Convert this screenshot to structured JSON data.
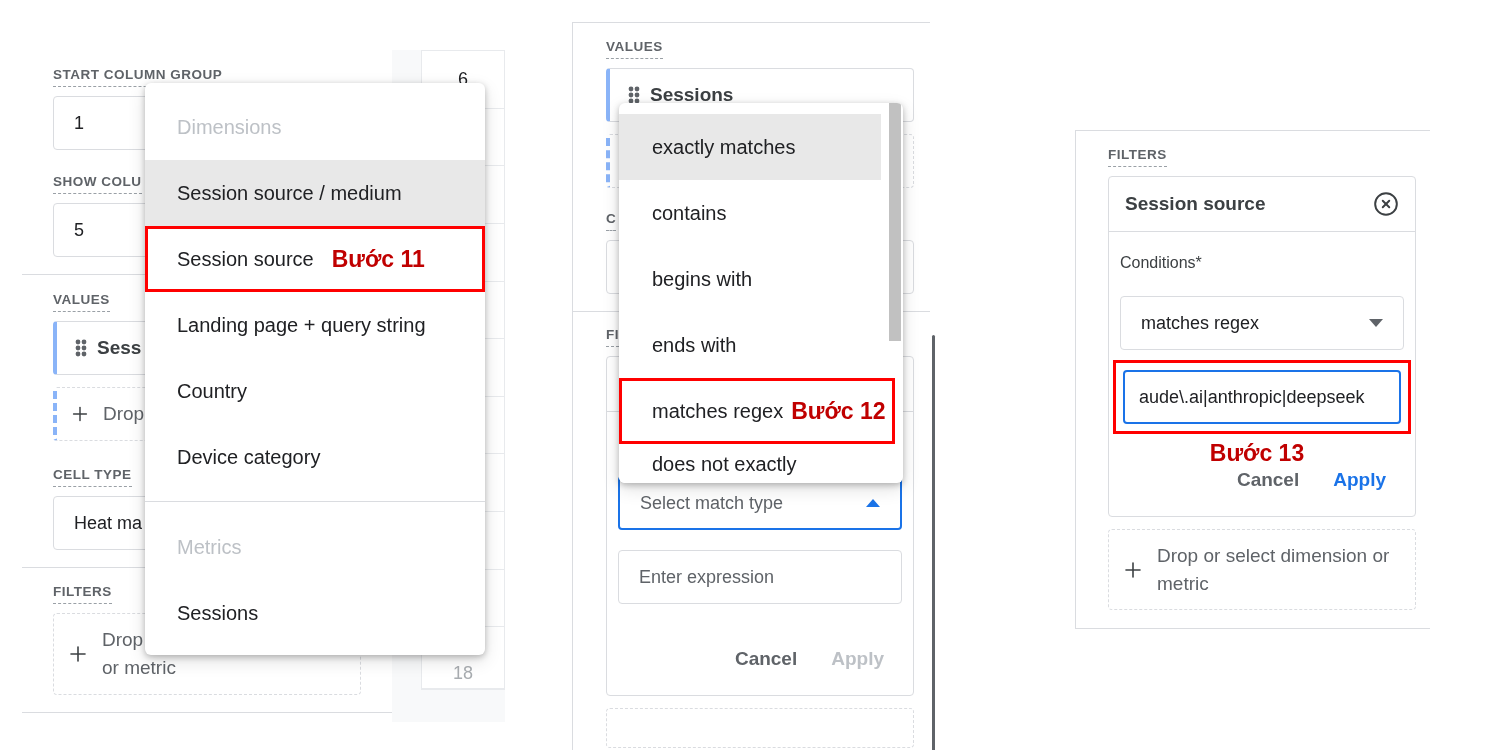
{
  "dimension_panel": {
    "fields": [
      {
        "label": "START COLUMN GROUP",
        "value": "1"
      },
      {
        "label": "SHOW COLU",
        "value": "5"
      }
    ],
    "values_label": "VALUES",
    "value_chip": "Sess",
    "drop_zone": "Drop",
    "cell_type": {
      "label": "CELL TYPE",
      "value": "Heat ma"
    },
    "filters_label": "FILTERS",
    "filters_drop": [
      "Drop",
      "or metric"
    ],
    "grid_cells": [
      {
        "text": "6",
        "faded": false
      },
      {
        "text": "18",
        "faded": true
      }
    ],
    "menu": {
      "sections": [
        {
          "heading": "Dimensions",
          "items": [
            {
              "label": "Session source / medium",
              "selected": true,
              "highlighted": false
            },
            {
              "label": "Session source",
              "selected": false,
              "highlighted": true,
              "annotation": "Bước 11"
            },
            {
              "label": "Landing page + query string",
              "selected": false,
              "highlighted": false
            },
            {
              "label": "Country",
              "selected": false,
              "highlighted": false
            },
            {
              "label": "Device category",
              "selected": false,
              "highlighted": false
            }
          ]
        },
        {
          "heading": "Metrics",
          "items": [
            {
              "label": "Sessions",
              "selected": false,
              "highlighted": false
            }
          ]
        }
      ]
    }
  },
  "match_panel": {
    "values_label": "VALUES",
    "value_chip": "Sessions",
    "cell_type_label": "C",
    "filters_label": "FI",
    "match_select": {
      "placeholder": "Select match type",
      "open": true
    },
    "expression": {
      "placeholder": "Enter expression"
    },
    "buttons": [
      {
        "label": "Cancel",
        "kind": "cancel",
        "disabled": false
      },
      {
        "label": "Apply",
        "kind": "apply",
        "disabled": true
      }
    ],
    "menu": {
      "items": [
        {
          "label": "exactly matches",
          "selected": true,
          "highlighted": false
        },
        {
          "label": "contains",
          "selected": false,
          "highlighted": false
        },
        {
          "label": "begins with",
          "selected": false,
          "highlighted": false
        },
        {
          "label": "ends with",
          "selected": false,
          "highlighted": false
        },
        {
          "label": "matches regex",
          "selected": false,
          "highlighted": true,
          "annotation": "Bước 12"
        },
        {
          "label": "does not exactly",
          "selected": false,
          "highlighted": false
        }
      ]
    }
  },
  "filter_panel": {
    "filters_label": "FILTERS",
    "filter": {
      "title": "Session source",
      "conditions_label": "Conditions*",
      "match_type": "matches regex",
      "expression": "aude\\.ai|anthropic|deepseek",
      "highlighted": true,
      "annotation": "Bước 13"
    },
    "buttons": [
      {
        "label": "Cancel",
        "kind": "cancel",
        "disabled": false
      },
      {
        "label": "Apply",
        "kind": "apply",
        "disabled": false
      }
    ],
    "drop_zone": "Drop or select dimension or metric"
  }
}
